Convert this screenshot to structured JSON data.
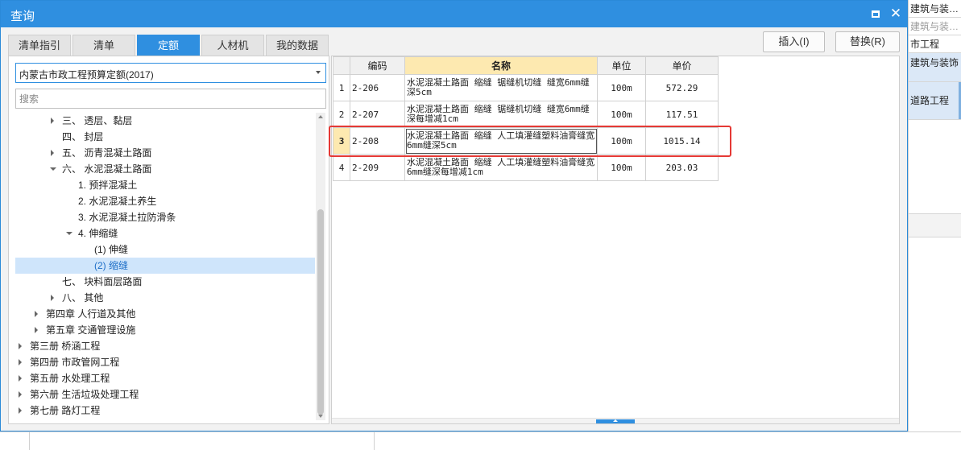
{
  "dialog": {
    "title": "查询"
  },
  "tabs": [
    {
      "label": "清单指引",
      "active": false
    },
    {
      "label": "清单",
      "active": false
    },
    {
      "label": "定额",
      "active": true
    },
    {
      "label": "人材机",
      "active": false
    },
    {
      "label": "我的数据",
      "active": false
    }
  ],
  "toolbar": {
    "insert_label": "插入(I)",
    "replace_label": "替换(R)"
  },
  "left": {
    "library_selected": "内蒙古市政工程预算定额(2017)",
    "search_placeholder": "搜索",
    "tree": [
      {
        "label": "三、 透层、黏层",
        "indent": 2,
        "expander": "collapsed"
      },
      {
        "label": "四、 封层",
        "indent": 2,
        "expander": "none"
      },
      {
        "label": "五、 沥青混凝土路面",
        "indent": 2,
        "expander": "collapsed"
      },
      {
        "label": "六、 水泥混凝土路面",
        "indent": 2,
        "expander": "expanded"
      },
      {
        "label": "1. 预拌混凝土",
        "indent": 3,
        "expander": "none"
      },
      {
        "label": "2. 水泥混凝土养生",
        "indent": 3,
        "expander": "none"
      },
      {
        "label": "3. 水泥混凝土拉防滑条",
        "indent": 3,
        "expander": "none"
      },
      {
        "label": "4. 伸缩缝",
        "indent": 3,
        "expander": "expanded"
      },
      {
        "label": "(1) 伸缝",
        "indent": 4,
        "expander": "none"
      },
      {
        "label": "(2) 缩缝",
        "indent": 4,
        "expander": "none",
        "selected": true
      },
      {
        "label": "七、 块料面层路面",
        "indent": 2,
        "expander": "none"
      },
      {
        "label": "八、 其他",
        "indent": 2,
        "expander": "collapsed"
      },
      {
        "label": "第四章 人行道及其他",
        "indent": 1,
        "expander": "collapsed"
      },
      {
        "label": "第五章 交通管理设施",
        "indent": 1,
        "expander": "collapsed"
      },
      {
        "label": "第三册 桥涵工程",
        "indent": 0,
        "expander": "collapsed"
      },
      {
        "label": "第四册 市政管网工程",
        "indent": 0,
        "expander": "collapsed"
      },
      {
        "label": "第五册 水处理工程",
        "indent": 0,
        "expander": "collapsed"
      },
      {
        "label": "第六册 生活垃圾处理工程",
        "indent": 0,
        "expander": "collapsed"
      },
      {
        "label": "第七册 路灯工程",
        "indent": 0,
        "expander": "collapsed"
      }
    ]
  },
  "grid": {
    "columns": {
      "code": "编码",
      "name": "名称",
      "unit": "单位",
      "price": "单价"
    },
    "rows": [
      {
        "index": "1",
        "code": "2-206",
        "name": "水泥混凝土路面 缩缝 锯缝机切缝 缝宽6mm缝深5cm",
        "unit": "100m",
        "price": "572.29"
      },
      {
        "index": "2",
        "code": "2-207",
        "name": "水泥混凝土路面 缩缝 锯缝机切缝 缝宽6mm缝深每增减1cm",
        "unit": "100m",
        "price": "117.51"
      },
      {
        "index": "3",
        "code": "2-208",
        "name": "水泥混凝土路面 缩缝 人工填灌缝塑料油膏缝宽6mm缝深5cm",
        "unit": "100m",
        "price": "1015.14",
        "current": true
      },
      {
        "index": "4",
        "code": "2-209",
        "name": "水泥混凝土路面 缩缝 人工填灌缝塑料油膏缝宽6mm缝深每增减1cm",
        "unit": "100m",
        "price": "203.03"
      }
    ]
  },
  "background": {
    "rows": [
      "建筑与装…",
      "建筑与装…",
      "市工程",
      "建筑与装饰",
      "道路工程"
    ]
  },
  "colors": {
    "accent": "#2f8fe0",
    "highlight": "#e53935",
    "header_name": "#fde9b0"
  }
}
